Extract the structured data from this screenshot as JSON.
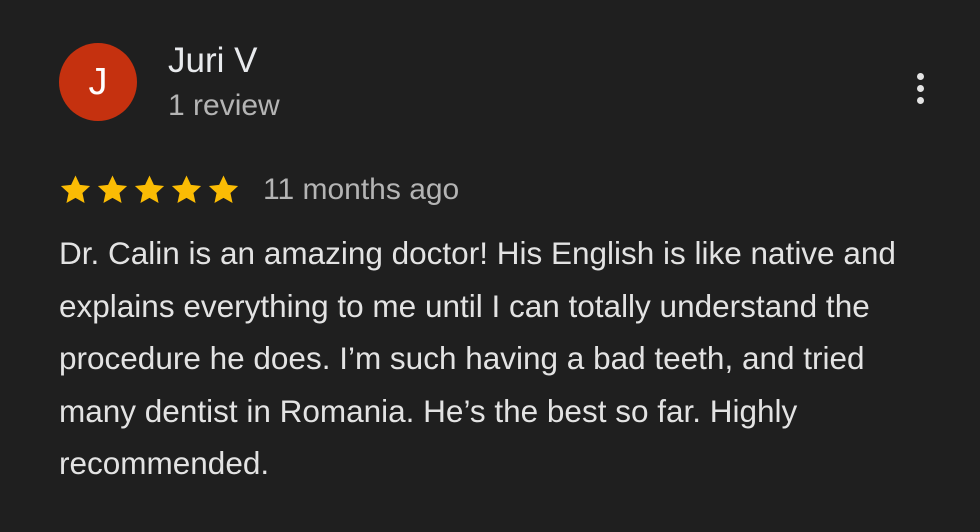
{
  "review": {
    "author": {
      "initial": "J",
      "name": "Juri V",
      "meta": "1 review",
      "avatar_color": "#c5310f"
    },
    "rating": {
      "stars": 5,
      "max_stars": 5,
      "star_color": "#fbbc04"
    },
    "time_ago": "11 months ago",
    "text": "Dr. Calin is an amazing doctor! His English is like native and explains everything to me until I can totally understand the procedure he does. I’m such having a bad teeth, and tried many dentist in Romania. He’s the best so far. Highly recommended.",
    "more_icon": "more-vert-icon"
  }
}
